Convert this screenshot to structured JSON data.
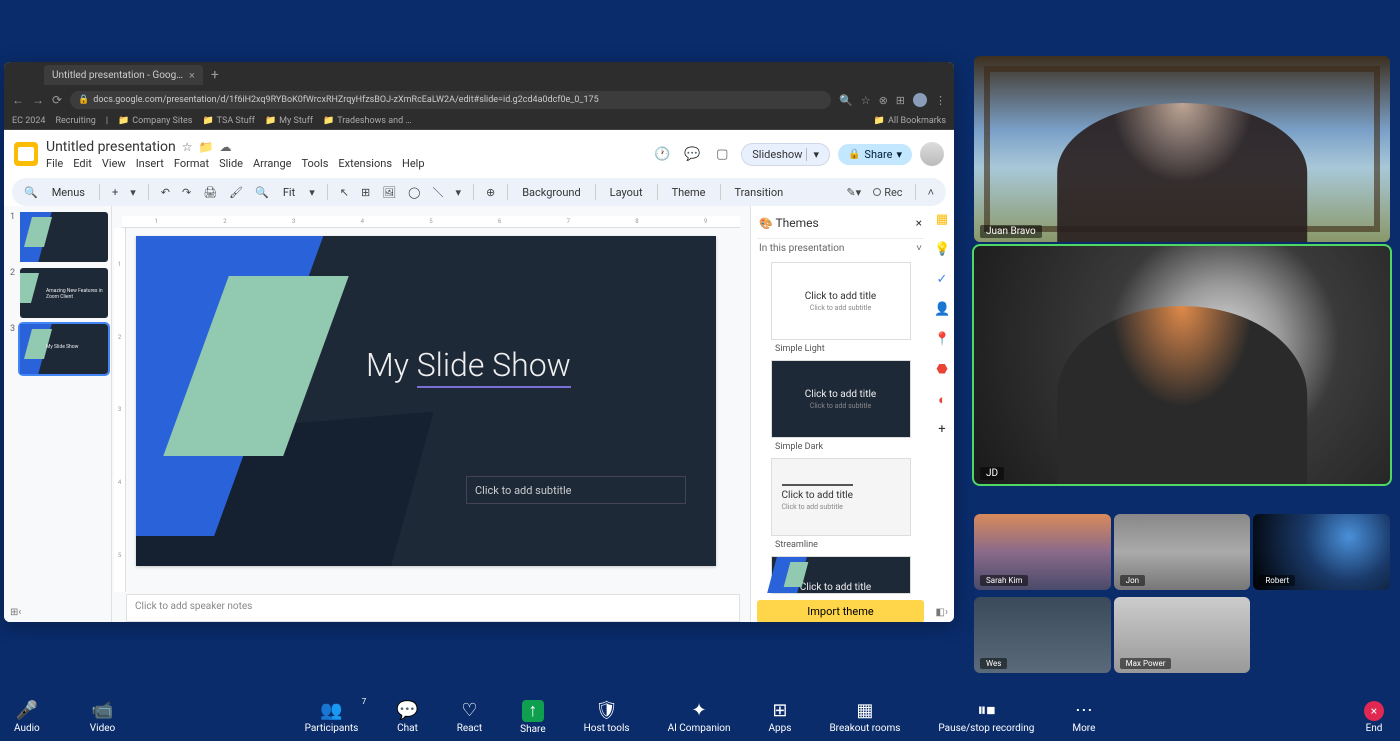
{
  "browser": {
    "tab_title": "Untitled presentation - Goog…",
    "url": "docs.google.com/presentation/d/1f6iH2xq9RYBoK0fWrcxRHZrqyHfzsBOJ-zXmRcEaLW2A/edit#slide=id.g2cd4a0dcf0e_0_175",
    "bookmarks": [
      "EC 2024",
      "Recruiting",
      "Company Sites",
      "TSA Stuff",
      "My Stuff",
      "Tradeshows and …"
    ],
    "all_bookmarks": "All Bookmarks"
  },
  "slides": {
    "title": "Untitled presentation",
    "menu": [
      "File",
      "Edit",
      "View",
      "Insert",
      "Format",
      "Slide",
      "Arrange",
      "Tools",
      "Extensions",
      "Help"
    ],
    "slideshow_label": "Slideshow",
    "share_label": "Share",
    "toolbar": {
      "menus": "Menus",
      "fit": "Fit",
      "background": "Background",
      "layout": "Layout",
      "theme": "Theme",
      "transition": "Transition",
      "rec": "Rec"
    },
    "thumbs": [
      {
        "num": "1",
        "text": ""
      },
      {
        "num": "2",
        "text": "Amazing New Features in Zoom Client"
      },
      {
        "num": "3",
        "text": "My Slide Show"
      }
    ],
    "canvas": {
      "title": "My Slide Show",
      "subtitle_placeholder": "Click to add subtitle"
    },
    "notes_placeholder": "Click to add speaker notes",
    "ruler_h": [
      "1",
      "2",
      "3",
      "4",
      "5",
      "6",
      "7",
      "8",
      "9"
    ],
    "ruler_v": [
      "1",
      "2",
      "3",
      "4",
      "5"
    ]
  },
  "themes": {
    "header": "Themes",
    "section": "In this presentation",
    "card_title": "Click to add title",
    "card_sub": "Click to add subtitle",
    "names": [
      "Simple Light",
      "Simple Dark",
      "Streamline"
    ],
    "import_label": "Import theme"
  },
  "participants": {
    "large": [
      {
        "name": "Juan Bravo"
      },
      {
        "name": "JD"
      }
    ],
    "small": [
      {
        "name": "Sarah Kim"
      },
      {
        "name": "Jon"
      },
      {
        "name": "Robert"
      },
      {
        "name": "Wes"
      },
      {
        "name": "Max Power"
      }
    ]
  },
  "zoom": {
    "controls": [
      {
        "id": "audio",
        "label": "Audio",
        "icon": "🎤"
      },
      {
        "id": "video",
        "label": "Video",
        "icon": "📹"
      },
      {
        "id": "participants",
        "label": "Participants",
        "icon": "👥",
        "badge": "7"
      },
      {
        "id": "chat",
        "label": "Chat",
        "icon": "💬"
      },
      {
        "id": "react",
        "label": "React",
        "icon": "♡"
      },
      {
        "id": "share",
        "label": "Share",
        "icon": "↑"
      },
      {
        "id": "host",
        "label": "Host tools",
        "icon": "🛡"
      },
      {
        "id": "ai",
        "label": "AI Companion",
        "icon": "✦"
      },
      {
        "id": "apps",
        "label": "Apps",
        "icon": "⊞"
      },
      {
        "id": "breakout",
        "label": "Breakout rooms",
        "icon": "▦"
      },
      {
        "id": "record",
        "label": "Pause/stop recording",
        "icon": "⏸⏹"
      },
      {
        "id": "more",
        "label": "More",
        "icon": "⋯"
      }
    ],
    "end_label": "End"
  }
}
